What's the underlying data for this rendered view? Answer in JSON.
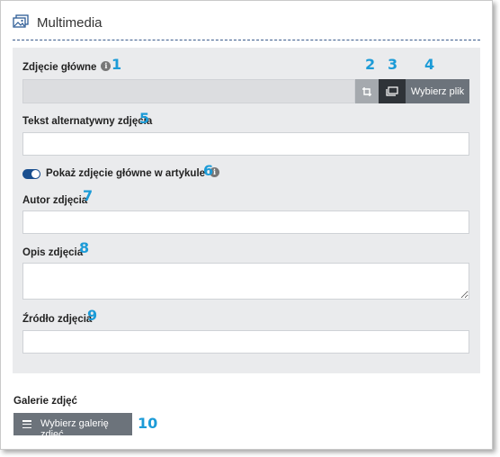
{
  "section": {
    "title": "Multimedia",
    "icon": "image-gallery-icon"
  },
  "fields": {
    "main_image": {
      "label": "Zdjęcie główne",
      "number": "1"
    },
    "crop_button": {
      "number": "2",
      "icon": "crop-icon"
    },
    "gallery_button": {
      "number": "3",
      "icon": "images-icon"
    },
    "choose_file": {
      "label": "Wybierz plik",
      "number": "4"
    },
    "alt_text": {
      "label": "Tekst alternatywny zdjęcia",
      "number": "5",
      "value": ""
    },
    "show_main": {
      "label": "Pokaż zdjęcie główne w artykule",
      "number": "6",
      "checked": true
    },
    "author": {
      "label": "Autor zdjęcia",
      "number": "7",
      "value": ""
    },
    "description": {
      "label": "Opis zdjęcia",
      "number": "8",
      "value": ""
    },
    "source": {
      "label": "Źródło zdjęcia",
      "number": "9",
      "value": ""
    }
  },
  "galleries": {
    "label": "Galerie zdjęć",
    "button_label": "Wybierz galerię zdjęć",
    "number": "10",
    "icon": "menu-icon"
  },
  "colors": {
    "accent_number": "#1c9bd7",
    "toggle_on": "#1a4f8f",
    "button_gray": "#6c737b",
    "button_dark": "#2f3338",
    "panel_bg": "#eaebed"
  }
}
